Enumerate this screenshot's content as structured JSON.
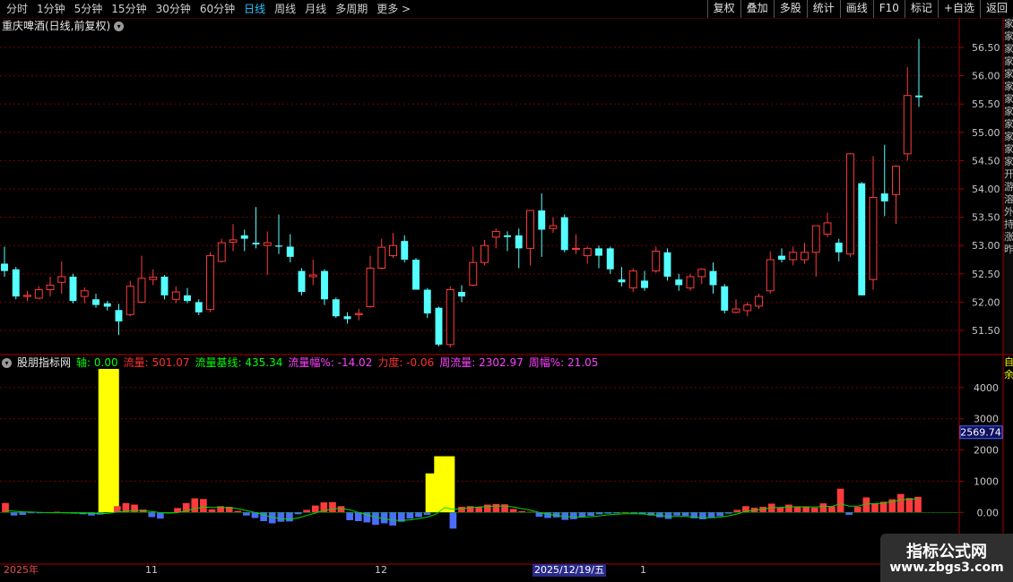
{
  "toolbar": {
    "tabs": [
      "分时",
      "1分钟",
      "5分钟",
      "15分钟",
      "30分钟",
      "60分钟",
      "日线",
      "周线",
      "月线",
      "多周期",
      "更多 >"
    ],
    "active_tab": "日线",
    "actions": [
      "复权",
      "叠加",
      "多股",
      "统计",
      "画线",
      "F10",
      "标记",
      "+自选",
      "返回"
    ]
  },
  "stock": {
    "title": "重庆啤酒(日线,前复权)",
    "collapse_icon": "chevron-down-icon"
  },
  "price_axis": {
    "ticks": [
      "56.50",
      "56.00",
      "55.50",
      "55.00",
      "54.50",
      "54.00",
      "53.50",
      "53.00",
      "52.50",
      "52.00",
      "51.50"
    ]
  },
  "indicator": {
    "name": "股朋指标网",
    "items": [
      {
        "label": "轴:",
        "value": "0.00",
        "color": "#00ff00"
      },
      {
        "label": "流量:",
        "value": "501.07",
        "color": "#ff3030"
      },
      {
        "label": "流量基线:",
        "value": "435.34",
        "color": "#00ff00"
      },
      {
        "label": "流量幅%:",
        "value": "-14.02",
        "color": "#ff40ff"
      },
      {
        "label": "力度:",
        "value": "-0.06",
        "color": "#ff3030"
      },
      {
        "label": "周流量:",
        "value": "2302.97",
        "color": "#ff40ff"
      },
      {
        "label": "周幅%:",
        "value": "21.05",
        "color": "#ff40ff"
      }
    ],
    "axis_ticks": [
      "4000",
      "3000",
      "2000",
      "1000",
      "0.00"
    ],
    "current_value": "2569.74"
  },
  "dates": [
    "2025年",
    "11",
    "12",
    "2025/12/19/五",
    "1"
  ],
  "right_strip_text": "家家家家家家家家家家家家开游溶外持涨昨",
  "right_strip_text2": "自余",
  "watermark": {
    "line1": "指标公式网",
    "line2": "www.zbgs3.com"
  },
  "colors": {
    "up": "#ff3b3b",
    "down": "#54ffff",
    "grid": "#7a0000",
    "yellow": "#ffff00",
    "blue": "#4a6cff",
    "baseline": "#00dd00"
  },
  "chart_data": [
    {
      "type": "candlestick",
      "title": "重庆啤酒(日线,前复权)",
      "ylim": [
        51.2,
        56.8
      ],
      "ohlc": [
        [
          52.68,
          52.98,
          52.45,
          52.55
        ],
        [
          52.58,
          52.62,
          52.05,
          52.1
        ],
        [
          52.1,
          52.2,
          52.02,
          52.12
        ],
        [
          52.07,
          52.28,
          52.05,
          52.22
        ],
        [
          52.22,
          52.45,
          52.1,
          52.3
        ],
        [
          52.35,
          52.72,
          52.15,
          52.45
        ],
        [
          52.45,
          52.5,
          51.98,
          52.02
        ],
        [
          52.1,
          52.26,
          51.98,
          52.2
        ],
        [
          52.05,
          52.15,
          51.9,
          51.95
        ],
        [
          51.98,
          52.02,
          51.85,
          51.92
        ],
        [
          51.86,
          51.97,
          51.42,
          51.66
        ],
        [
          51.78,
          52.38,
          51.75,
          52.28
        ],
        [
          52.0,
          52.82,
          51.98,
          52.42
        ],
        [
          52.4,
          52.58,
          52.3,
          52.44
        ],
        [
          52.45,
          52.48,
          52.05,
          52.12
        ],
        [
          52.05,
          52.28,
          51.98,
          52.18
        ],
        [
          52.12,
          52.25,
          51.98,
          52.02
        ],
        [
          52.0,
          52.05,
          51.77,
          51.82
        ],
        [
          51.87,
          52.88,
          51.82,
          52.82
        ],
        [
          52.72,
          53.12,
          52.7,
          53.05
        ],
        [
          53.06,
          53.38,
          52.9,
          53.1
        ],
        [
          53.18,
          53.28,
          52.9,
          53.12
        ],
        [
          53.05,
          53.68,
          52.95,
          53.02
        ],
        [
          53.0,
          53.25,
          52.48,
          53.05
        ],
        [
          53.0,
          53.55,
          52.85,
          52.98
        ],
        [
          52.98,
          53.2,
          52.7,
          52.8
        ],
        [
          52.55,
          52.6,
          52.12,
          52.18
        ],
        [
          52.45,
          52.75,
          52.3,
          52.48
        ],
        [
          52.55,
          52.58,
          51.95,
          52.05
        ],
        [
          52.05,
          52.08,
          51.72,
          51.75
        ],
        [
          51.75,
          51.82,
          51.62,
          51.7
        ],
        [
          51.78,
          51.88,
          51.68,
          51.8
        ],
        [
          51.92,
          52.82,
          51.9,
          52.6
        ],
        [
          52.6,
          53.12,
          52.58,
          52.97
        ],
        [
          52.82,
          53.22,
          52.78,
          53.0
        ],
        [
          53.08,
          53.18,
          52.7,
          52.75
        ],
        [
          52.75,
          52.78,
          52.22,
          52.22
        ],
        [
          52.22,
          52.25,
          51.72,
          51.8
        ],
        [
          51.9,
          51.92,
          51.22,
          51.25
        ],
        [
          51.25,
          52.28,
          51.2,
          52.22
        ],
        [
          52.18,
          52.3,
          52.0,
          52.1
        ],
        [
          52.3,
          52.98,
          52.28,
          52.7
        ],
        [
          52.7,
          53.1,
          52.65,
          53.0
        ],
        [
          53.15,
          53.3,
          52.95,
          53.25
        ],
        [
          53.18,
          53.25,
          52.9,
          53.15
        ],
        [
          53.18,
          53.3,
          52.6,
          52.95
        ],
        [
          52.95,
          53.18,
          52.65,
          53.62
        ],
        [
          53.62,
          53.92,
          52.8,
          53.28
        ],
        [
          53.3,
          53.5,
          53.22,
          53.35
        ],
        [
          53.5,
          53.55,
          52.88,
          52.92
        ],
        [
          52.95,
          53.2,
          52.85,
          52.95
        ],
        [
          52.82,
          52.98,
          52.68,
          52.95
        ],
        [
          52.95,
          53.0,
          52.6,
          52.82
        ],
        [
          52.95,
          52.98,
          52.5,
          52.58
        ],
        [
          52.4,
          52.62,
          52.28,
          52.35
        ],
        [
          52.25,
          52.6,
          52.18,
          52.55
        ],
        [
          52.38,
          52.55,
          52.2,
          52.25
        ],
        [
          52.55,
          52.98,
          52.52,
          52.9
        ],
        [
          52.88,
          52.95,
          52.38,
          52.45
        ],
        [
          52.4,
          52.5,
          52.2,
          52.3
        ],
        [
          52.25,
          52.5,
          52.2,
          52.45
        ],
        [
          52.45,
          52.6,
          52.32,
          52.58
        ],
        [
          52.55,
          52.7,
          52.15,
          52.3
        ],
        [
          52.28,
          52.32,
          51.8,
          51.85
        ],
        [
          51.82,
          52.05,
          51.8,
          51.88
        ],
        [
          51.85,
          52.0,
          51.75,
          51.95
        ],
        [
          51.93,
          52.15,
          51.88,
          52.1
        ],
        [
          52.2,
          52.9,
          52.15,
          52.75
        ],
        [
          52.82,
          52.95,
          52.7,
          52.75
        ],
        [
          52.75,
          52.98,
          52.65,
          52.88
        ],
        [
          52.75,
          53.05,
          52.68,
          52.88
        ],
        [
          52.88,
          53.18,
          52.45,
          53.35
        ],
        [
          53.2,
          53.58,
          53.15,
          53.4
        ],
        [
          53.05,
          53.12,
          52.72,
          52.88
        ],
        [
          52.85,
          54.62,
          52.8,
          54.62
        ],
        [
          54.1,
          54.12,
          52.12,
          52.12
        ],
        [
          52.4,
          54.58,
          52.22,
          53.85
        ],
        [
          53.92,
          54.78,
          53.52,
          53.78
        ],
        [
          53.9,
          54.42,
          53.38,
          54.4
        ],
        [
          54.62,
          56.15,
          54.5,
          55.65
        ],
        [
          55.65,
          56.65,
          55.45,
          55.62
        ]
      ]
    },
    {
      "type": "bar",
      "title": "股朋指标网",
      "ylim": [
        -1600,
        4600
      ],
      "series": [
        {
          "name": "流量",
          "values": [
            300,
            -100,
            -80,
            -20,
            -10,
            10,
            20,
            -20,
            -40,
            -60,
            -100,
            -70,
            4600,
            200,
            300,
            250,
            90,
            -150,
            -200,
            -20,
            140,
            300,
            450,
            430,
            100,
            200,
            180,
            50,
            -100,
            -180,
            -280,
            -350,
            -300,
            -290,
            -60,
            80,
            220,
            320,
            330,
            200,
            -250,
            -280,
            -320,
            -400,
            -350,
            -420,
            -300,
            -200,
            -150,
            -80,
            1250,
            1800,
            -520,
            180,
            200,
            170,
            250,
            270,
            260,
            110,
            40,
            20,
            -140,
            -180,
            -160,
            -240,
            -220,
            -140,
            -110,
            -60,
            -40,
            -30,
            10,
            -30,
            -60,
            -100,
            -160,
            -210,
            -100,
            -110,
            -190,
            -220,
            -160,
            -120,
            -40,
            80,
            200,
            150,
            180,
            280,
            160,
            250,
            180,
            180,
            150,
            290,
            190,
            760,
            -80,
            180,
            480,
            280,
            340,
            420,
            590,
            460,
            501
          ]
        },
        {
          "name": "流量基线",
          "values": [
            60,
            40,
            20,
            10,
            0,
            -10,
            -10,
            -15,
            -20,
            -25,
            -30,
            -40,
            -30,
            10,
            40,
            60,
            60,
            30,
            -10,
            -20,
            -10,
            50,
            120,
            170,
            160,
            160,
            150,
            120,
            60,
            0,
            -80,
            -160,
            -200,
            -220,
            -180,
            -100,
            -20,
            60,
            110,
            130,
            80,
            0,
            -80,
            -150,
            -200,
            -250,
            -260,
            -240,
            -200,
            -150,
            -60,
            150,
            100,
            120,
            150,
            170,
            190,
            200,
            200,
            170,
            120,
            70,
            0,
            -60,
            -100,
            -130,
            -150,
            -150,
            -140,
            -110,
            -80,
            -60,
            -40,
            -40,
            -50,
            -70,
            -100,
            -130,
            -130,
            -130,
            -150,
            -170,
            -170,
            -150,
            -110,
            -50,
            30,
            70,
            100,
            150,
            160,
            180,
            180,
            180,
            170,
            190,
            190,
            280,
            200,
            200,
            270,
            280,
            300,
            340,
            400,
            420,
            435.34
          ]
        }
      ]
    }
  ]
}
